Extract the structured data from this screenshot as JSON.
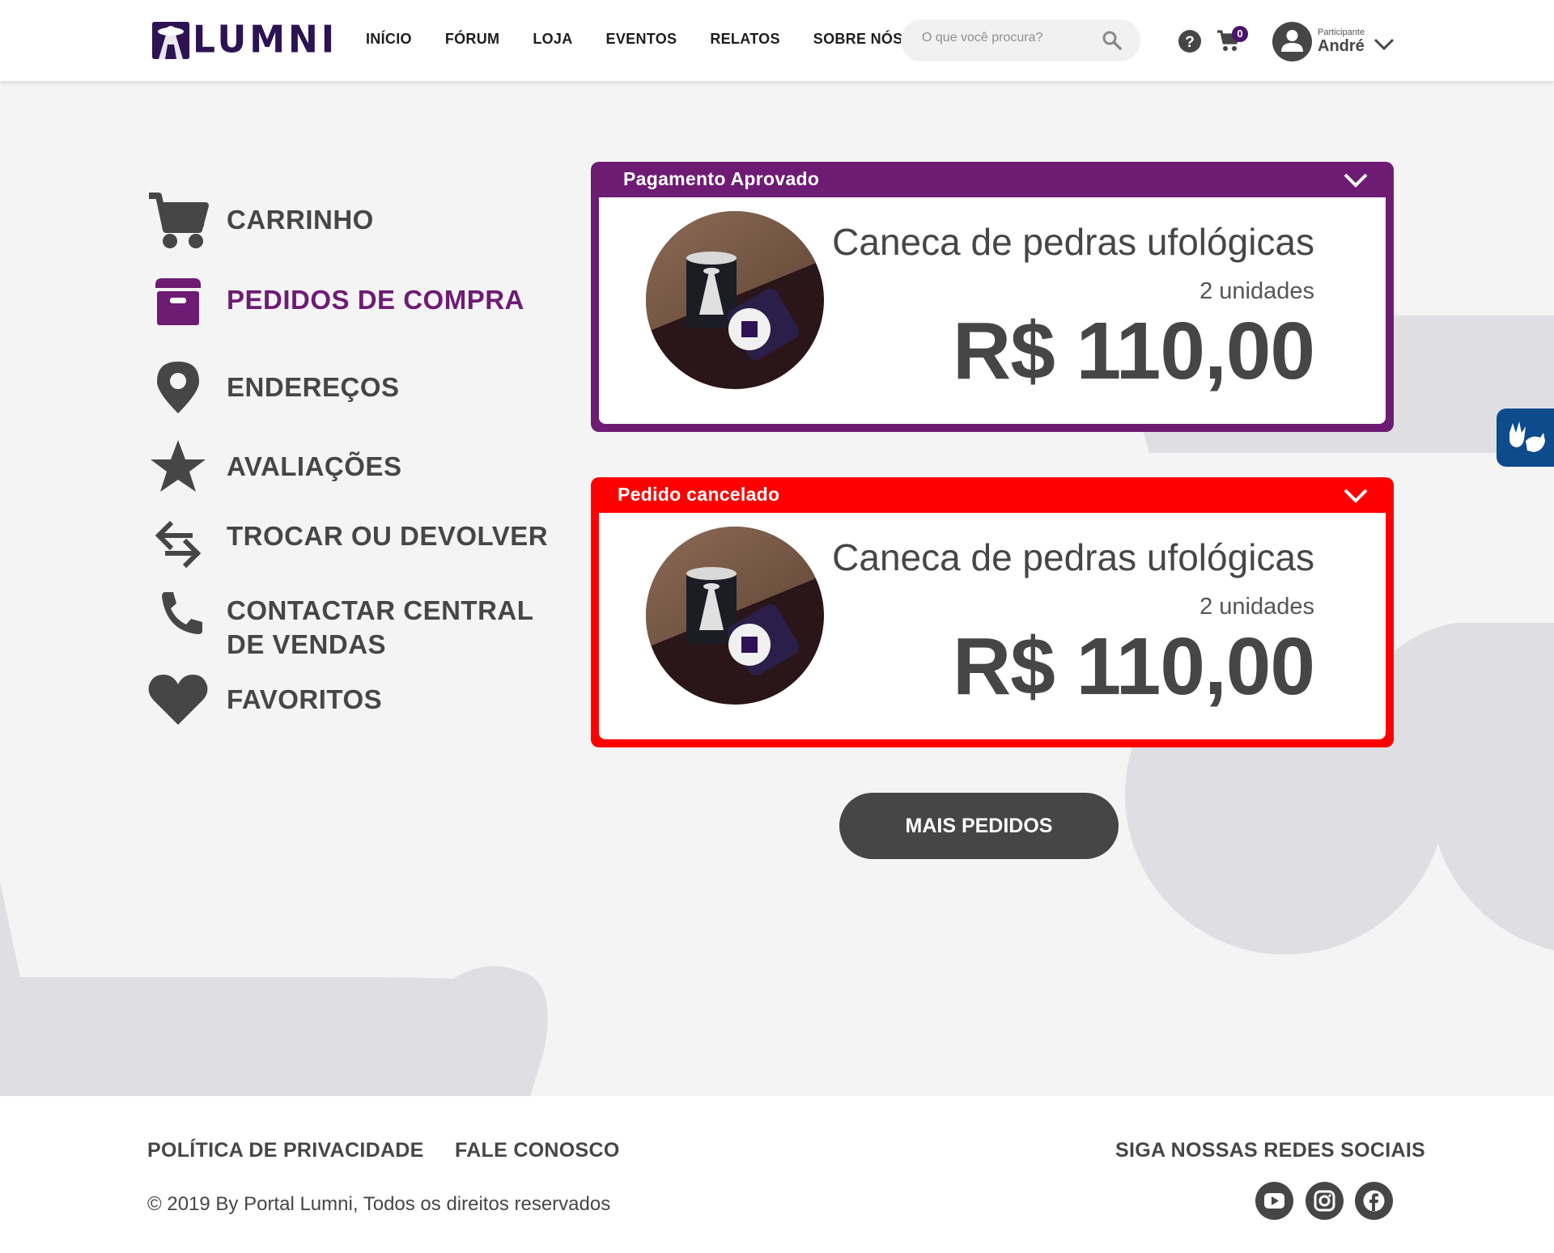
{
  "header": {
    "logo_text": "LUMNI",
    "nav": [
      "INÍCIO",
      "FÓRUM",
      "LOJA",
      "EVENTOS",
      "RELATOS",
      "SOBRE NÓS"
    ],
    "search_placeholder": "O que você procura?",
    "cart_count": "0",
    "user_role": "Participante",
    "user_name": "André"
  },
  "sidebar": {
    "items": [
      {
        "label": "CARRINHO",
        "icon": "cart-icon",
        "active": false
      },
      {
        "label": "PEDIDOS DE COMPRA",
        "icon": "box-icon",
        "active": true
      },
      {
        "label": "ENDEREÇOS",
        "icon": "location-pin-icon",
        "active": false
      },
      {
        "label": "AVALIAÇÕES",
        "icon": "star-icon",
        "active": false
      },
      {
        "label": "TROCAR OU DEVOLVER",
        "icon": "exchange-arrows-icon",
        "active": false
      },
      {
        "label": "CONTACTAR CENTRAL",
        "label2": "DE VENDAS",
        "icon": "phone-icon",
        "active": false
      },
      {
        "label": "FAVORITOS",
        "icon": "heart-icon",
        "active": false
      }
    ]
  },
  "orders": [
    {
      "status": "Pagamento Aprovado",
      "status_color": "#6e1c73",
      "product": "Caneca de pedras ufológicas",
      "quantity": "2 unidades",
      "price": "R$ 110,00"
    },
    {
      "status": "Pedido cancelado",
      "status_color": "#ff0000",
      "product": "Caneca de pedras ufológicas",
      "quantity": "2 unidades",
      "price": "R$ 110,00"
    }
  ],
  "more_button": "MAIS PEDIDOS",
  "footer": {
    "privacy": "POLÍTICA DE PRIVACIDADE",
    "contact": "FALE CONOSCO",
    "social_title": "SIGA NOSSAS REDES SOCIAIS",
    "copyright": "© 2019 By Portal Lumni, Todos os direitos reservados",
    "social": [
      "youtube-icon",
      "instagram-icon",
      "facebook-icon"
    ]
  },
  "colors": {
    "brand_purple": "#6e1c73",
    "dark_gray": "#464646",
    "cancel_red": "#ff0000",
    "background": "#f4f4f4"
  }
}
